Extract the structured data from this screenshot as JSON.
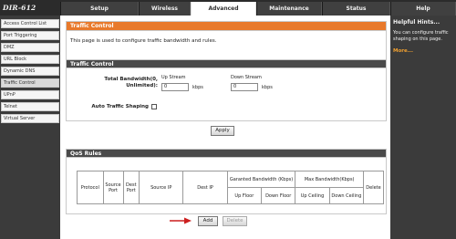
{
  "header": {
    "brand": "DIR-612",
    "tabs": [
      "Setup",
      "Wireless",
      "Advanced",
      "Maintenance",
      "Status",
      "Help"
    ],
    "active_tab": "Advanced"
  },
  "sidebar": {
    "items": [
      {
        "label": "Access Control List"
      },
      {
        "label": "Port Triggering"
      },
      {
        "label": "DMZ"
      },
      {
        "label": "URL Block"
      },
      {
        "label": "Dynamic DNS"
      },
      {
        "label": "Traffic Control"
      },
      {
        "label": "UPnP"
      },
      {
        "label": "Telnet"
      },
      {
        "label": "Virtual Server"
      }
    ],
    "selected": "Traffic Control"
  },
  "main": {
    "intro": {
      "title": "Traffic Control",
      "description": "This page is used to configure traffic bandwidth and rules."
    },
    "traffic_control": {
      "title": "Traffic Control",
      "total_bandwidth_label_line1": "Total Bandwidth(0,",
      "total_bandwidth_label_line2": "Unlimited):",
      "up_stream_label": "Up Stream",
      "up_stream_value": "0",
      "down_stream_label": "Down Stream",
      "down_stream_value": "0",
      "unit": "kbps",
      "auto_shaping_label": "Auto Traffic Shaping",
      "auto_shaping_checked": false,
      "apply_label": "Apply"
    },
    "qos_rules": {
      "title": "QoS Rules",
      "columns": {
        "protocol": "Protocol",
        "source_port": "Source Port",
        "dest_port": "Dest Port",
        "source_ip": "Source IP",
        "dest_ip": "Dest IP",
        "guaranteed": "Garanted Bandwidth (Kbps)",
        "up_floor": "Up Floor",
        "down_floor": "Down Floor",
        "max_bandwidth": "Max Bandwidth(Kbps)",
        "up_ceiling": "Up Ceiling",
        "down_ceiling": "Down Ceiling",
        "delete": "Delete"
      },
      "add_label": "Add",
      "delete_label": "Delete"
    }
  },
  "help": {
    "title": "Helpful Hints...",
    "text": "You can configure traffic shaping on this page.",
    "more": "More..."
  },
  "colors": {
    "orange_header": "#e8792b",
    "dark_header": "#4a4a4a",
    "arrow": "#cc1f1f"
  }
}
